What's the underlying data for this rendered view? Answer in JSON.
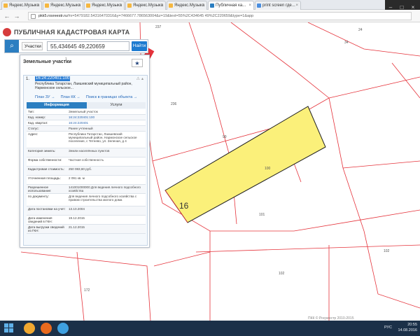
{
  "browser": {
    "tabs": [
      {
        "label": "Яндекс.Музыка",
        "active": false
      },
      {
        "label": "Яндекс.Музыка",
        "active": false
      },
      {
        "label": "Яндекс.Музыка",
        "active": false
      },
      {
        "label": "Яндекс.Музыка",
        "active": false
      },
      {
        "label": "Яндекс.Музыка",
        "active": false
      },
      {
        "label": "Публичная ка...",
        "active": true
      },
      {
        "label": "print screen где...",
        "active": false
      }
    ],
    "url_host": "pkk5.rosreestr.ru",
    "url_rest": "/#x=5479182.54316470316&y=7466677.786563004&z=19&text=55%2C434645 49%2C220659&type=1&app"
  },
  "app": {
    "title": "ПУБЛИЧНАЯ КАДАСТРОВАЯ КАРТА"
  },
  "search": {
    "type_label": "Участки",
    "query": "55,434645 49,220659",
    "button": "Найти"
  },
  "panel": {
    "title": "Земельные участки",
    "count": "1",
    "item": {
      "index": "1.",
      "cad_number": "16:24:220401:100",
      "address": "Республика Татарстан, Лаишевский муниципальный район, Нармонское сельское...",
      "links": [
        "План ЗУ →",
        "План КК →",
        "Поиск в границах объекта →"
      ],
      "tabs": [
        "Информация",
        "Услуги"
      ],
      "rows": [
        {
          "k": "Тип:",
          "v": "Земельный участок"
        },
        {
          "k": "Кад. номер:",
          "v": "16:24:220401:100",
          "link": true
        },
        {
          "k": "Кад. квартал:",
          "v": "16:24:220401",
          "link": true
        },
        {
          "k": "Статус:",
          "v": "Ранее учтенный"
        },
        {
          "k": "Адрес:",
          "v": "Республика Татарстан, Лаишевский муниципальный район, Нармонское сельское поселение, с Тетеево, ул. Зеленая, д 4"
        },
        {
          "k": "Категория земель:",
          "v": "Земли населённых пунктов"
        },
        {
          "k": "Форма собственности:",
          "v": "Частная собственность"
        },
        {
          "k": "Кадастровая стоимость:",
          "v": "250 083,60 руб."
        },
        {
          "k": "Уточненная площадь:",
          "v": "2 091 кв. м"
        },
        {
          "k": "Разрешенное использование:",
          "v": "141001000000 Для ведения личного подсобного хозяйства"
        },
        {
          "k": "по документу:",
          "v": "Для ведения личного подсобного хозяйства с правом строительства жилого дома"
        },
        {
          "k": "Дата постановки на учет:",
          "v": "13.10.2004"
        },
        {
          "k": "Дата изменения сведений в ГКН:",
          "v": "19.12.2015"
        },
        {
          "k": "Дата выгрузки сведений из ГКН:",
          "v": "21.12.2015"
        }
      ]
    }
  },
  "map": {
    "labels": [
      "237",
      "24",
      "34",
      "236",
      "99",
      "100",
      "101",
      "102",
      "102",
      "172",
      "16"
    ],
    "highlight_color": "#fbf07a"
  },
  "footer": {
    "copyright": "ПКК © Росреестр 2010-2015"
  },
  "taskbar": {
    "lang": "РУС",
    "time": "20:55",
    "date": "14.08.2016"
  }
}
